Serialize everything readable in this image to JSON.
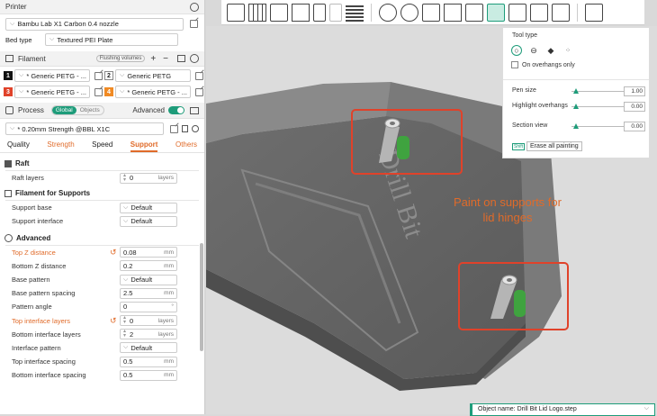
{
  "printer": {
    "section_title": "Printer",
    "name": "Bambu Lab X1 Carbon 0.4 nozzle",
    "bed_type_label": "Bed type",
    "bed_type_value": "Textured PEI Plate"
  },
  "filament": {
    "section_title": "Filament",
    "flushing_button": "Flushing volumes",
    "add": "+",
    "remove": "−",
    "slots": [
      {
        "num": "1",
        "color": "#111111",
        "name": "* Generic PETG - ..."
      },
      {
        "num": "2",
        "color": "#ffffff",
        "name": "Generic PETG"
      },
      {
        "num": "3",
        "color": "#e0422a",
        "name": "* Generic PETG - ..."
      },
      {
        "num": "4",
        "color": "#f08a24",
        "name": "* Generic PETG - ..."
      }
    ]
  },
  "process": {
    "section_title": "Process",
    "toggle_global": "Global",
    "toggle_objects": "Objects",
    "advanced_label": "Advanced",
    "preset": "* 0.20mm Strength @BBL X1C",
    "tabs": [
      "Quality",
      "Strength",
      "Speed",
      "Support",
      "Others"
    ]
  },
  "raft": {
    "title": "Raft",
    "layers_label": "Raft layers",
    "layers_value": "0",
    "layers_unit": "layers"
  },
  "filament_supports": {
    "title": "Filament for Supports",
    "base_label": "Support base",
    "base_value": "Default",
    "interface_label": "Support interface",
    "interface_value": "Default"
  },
  "advanced": {
    "title": "Advanced",
    "params": [
      {
        "label": "Top Z distance",
        "value": "0.08",
        "unit": "mm",
        "kind": "text",
        "modified": true
      },
      {
        "label": "Bottom Z distance",
        "value": "0.2",
        "unit": "mm",
        "kind": "text",
        "modified": false
      },
      {
        "label": "Base pattern",
        "value": "Default",
        "unit": "",
        "kind": "dropdown",
        "modified": false
      },
      {
        "label": "Base pattern spacing",
        "value": "2.5",
        "unit": "mm",
        "kind": "text",
        "modified": false
      },
      {
        "label": "Pattern angle",
        "value": "0",
        "unit": "°",
        "kind": "text",
        "modified": false
      },
      {
        "label": "Top interface layers",
        "value": "0",
        "unit": "layers",
        "kind": "spin",
        "modified": true
      },
      {
        "label": "Bottom interface layers",
        "value": "2",
        "unit": "layers",
        "kind": "spin",
        "modified": false
      },
      {
        "label": "Interface pattern",
        "value": "Default",
        "unit": "",
        "kind": "dropdown",
        "modified": false
      },
      {
        "label": "Top interface spacing",
        "value": "0.5",
        "unit": "mm",
        "kind": "text",
        "modified": false
      },
      {
        "label": "Bottom interface spacing",
        "value": "0.5",
        "unit": "mm",
        "kind": "text",
        "modified": false
      }
    ]
  },
  "paint_popup": {
    "tool_type_label": "Tool type",
    "overhangs_only": "On overhangs only",
    "pen_size_label": "Pen size",
    "pen_size_value": "1.00",
    "highlight_label": "Highlight overhangs",
    "highlight_value": "0.00",
    "section_label": "Section view",
    "section_value": "0.00",
    "shortcut_badge": "Shift",
    "erase_button": "Erase all painting"
  },
  "model": {
    "emboss_text": "Drill Bit"
  },
  "annotation": {
    "line1": "Paint on supports for",
    "line2": "lid hinges",
    "color": "#e0422a"
  },
  "object_bar": {
    "text": "Object name: Drill Bit Lid Logo.step"
  },
  "colors": {
    "accent": "#1e9c7a",
    "modified": "#e06b2a",
    "support_paint": "#3fa33f"
  }
}
